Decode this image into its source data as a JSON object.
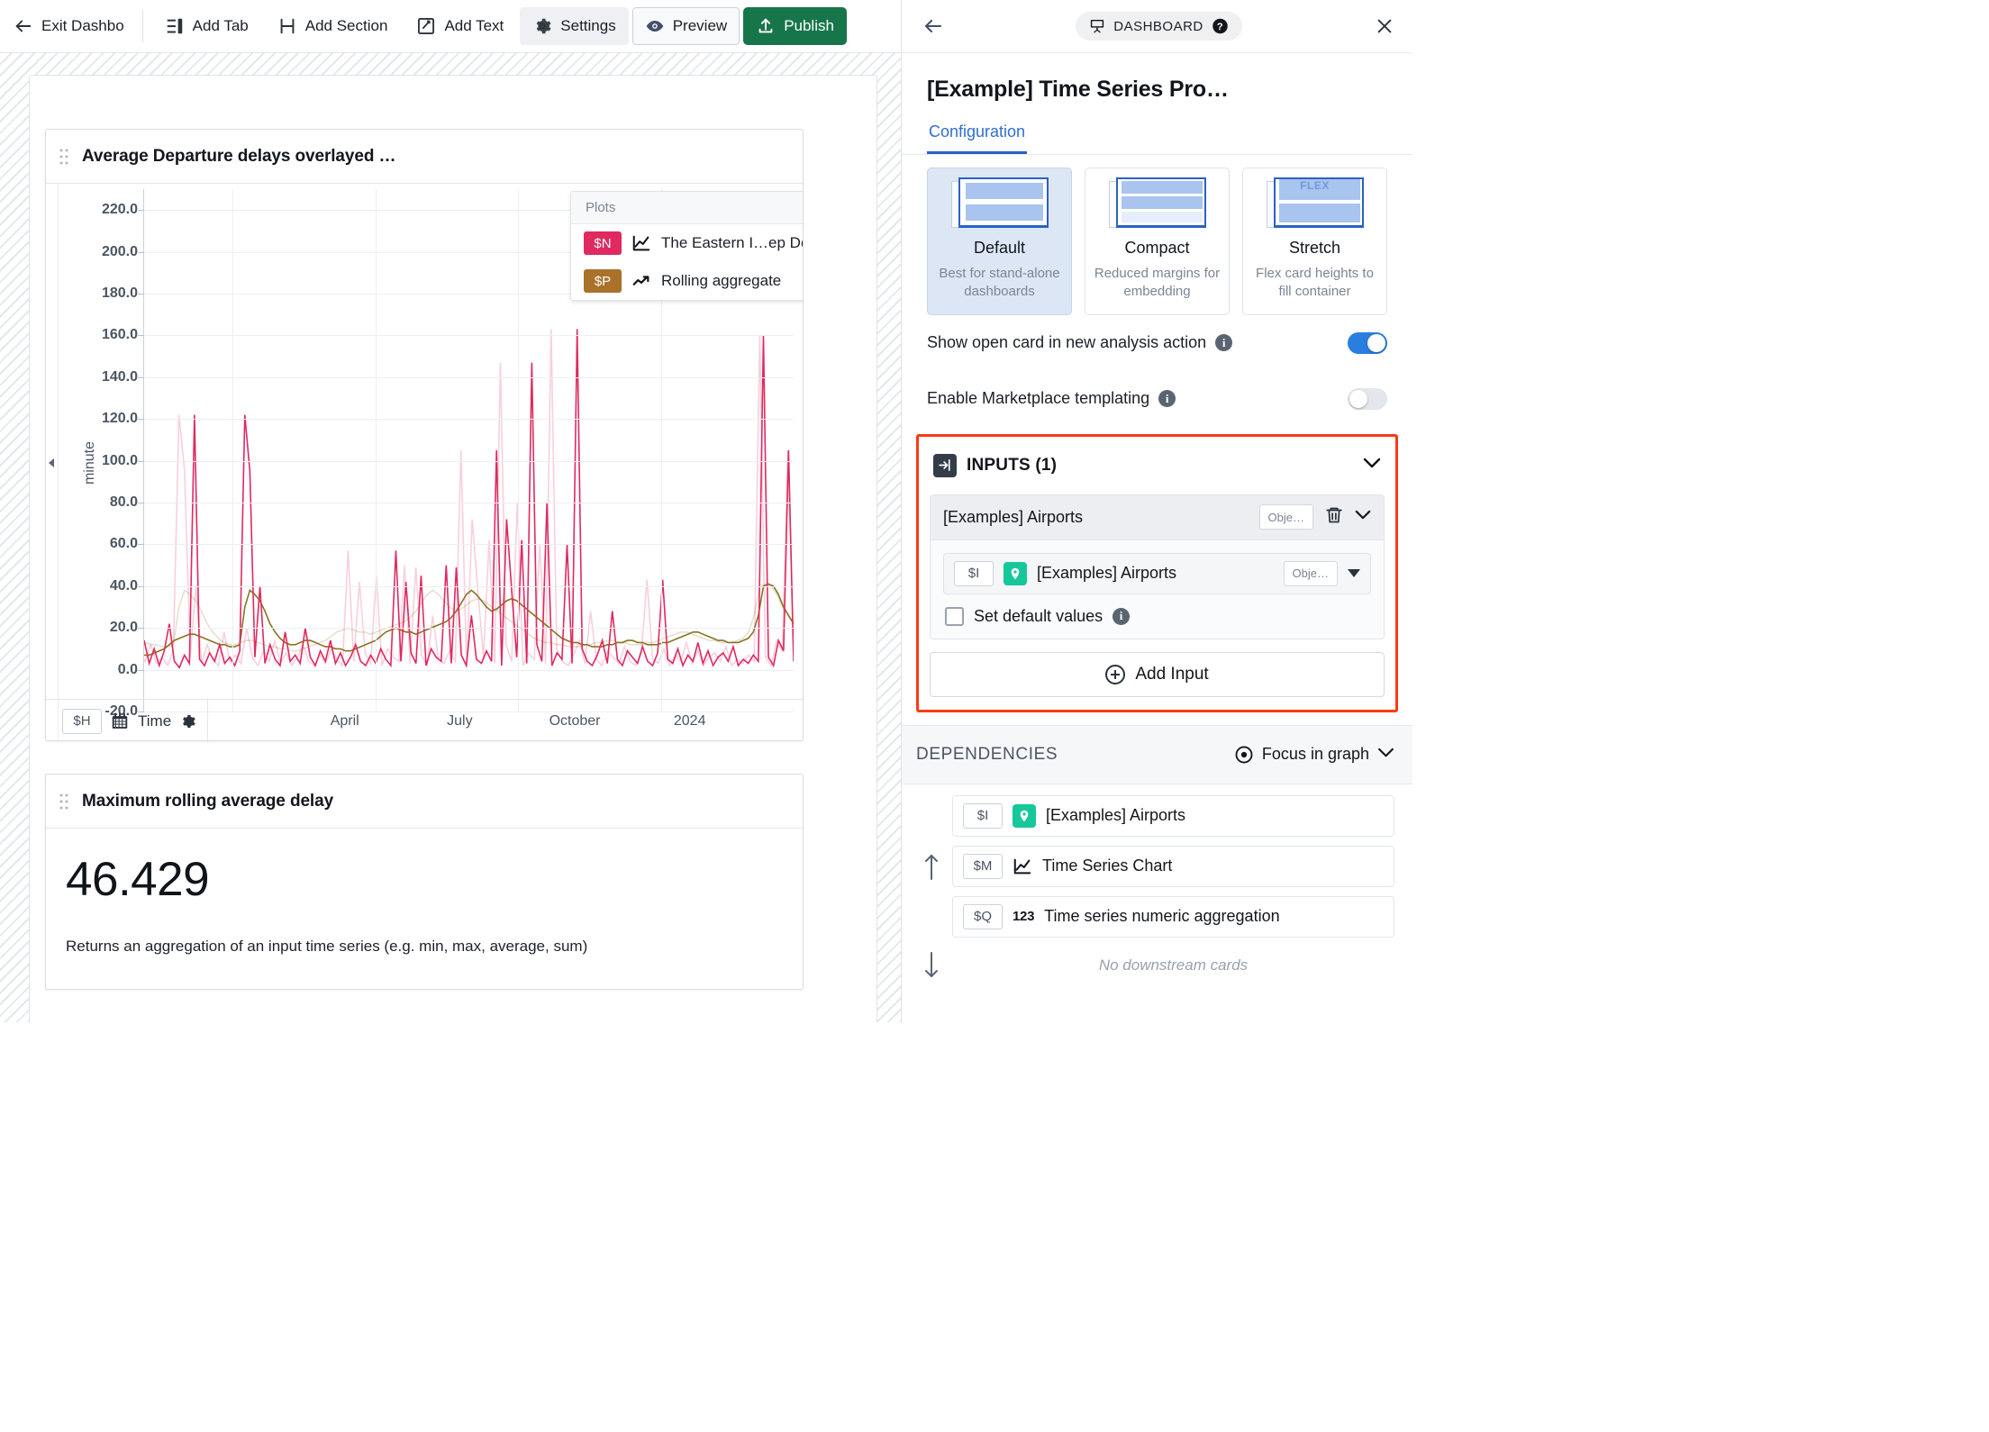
{
  "toolbar": {
    "exit_label": "Exit Dashbo",
    "add_tab_label": "Add Tab",
    "add_section_label": "Add Section",
    "add_text_label": "Add Text",
    "settings_label": "Settings",
    "preview_label": "Preview",
    "publish_label": "Publish",
    "publish_color": "#17754a"
  },
  "chart_card": {
    "title": "Average Departure delays overlayed …",
    "plots_tooltip": {
      "header": "Plots",
      "rows": [
        {
          "tag": "$N",
          "tag_color": "#e0295f",
          "icon": "line-chart-icon",
          "label": "The Eastern I…ep Delay"
        },
        {
          "tag": "$P",
          "tag_color": "#a9712a",
          "icon": "trend-up-icon",
          "label": "Rolling aggregate"
        }
      ]
    },
    "footer": {
      "variable_tag": "$H",
      "time_label": "Time",
      "gear_icon": "gear-icon"
    }
  },
  "chart_data": {
    "type": "line",
    "title": "Average Departure delays overlayed …",
    "xlabel": "",
    "ylabel": "minute",
    "ylim": [
      -20,
      230
    ],
    "yticks": [
      220.0,
      200.0,
      180.0,
      160.0,
      140.0,
      120.0,
      100.0,
      80.0,
      60.0,
      40.0,
      20.0,
      0.0,
      -20.0
    ],
    "ytick_labels": [
      "220.0",
      "200.0",
      "180.0",
      "160.0",
      "140.0",
      "120.0",
      "100.0",
      "80.0",
      "60.0",
      "40.0",
      "20.0",
      "0.0",
      "-20.0"
    ],
    "xticks": [
      "April",
      "July",
      "October",
      "2024"
    ],
    "grid": true,
    "legend_position": "floating-top-right",
    "series": [
      {
        "name": "The Eastern I…ep Delay",
        "tag": "$N",
        "color": "#e0295f",
        "values": [
          14,
          3,
          10,
          2,
          9,
          22,
          4,
          1,
          7,
          3,
          122,
          5,
          2,
          8,
          4,
          12,
          3,
          6,
          2,
          9,
          122,
          95,
          6,
          40,
          3,
          12,
          5,
          2,
          18,
          4,
          7,
          3,
          20,
          6,
          2,
          9,
          4,
          14,
          3,
          8,
          2,
          6,
          12,
          4,
          2,
          7,
          3,
          10,
          5,
          2,
          57,
          4,
          42,
          8,
          3,
          45,
          2,
          10,
          6,
          4,
          50,
          3,
          49,
          7,
          2,
          26,
          5,
          3,
          9,
          4,
          105,
          2,
          72,
          38,
          6,
          62,
          3,
          147,
          12,
          4,
          80,
          2,
          8,
          5,
          60,
          3,
          163,
          10,
          4,
          2,
          7,
          14,
          3,
          28,
          5,
          2,
          9,
          6,
          3,
          11,
          4,
          2,
          8,
          43,
          5,
          3,
          10,
          2,
          7,
          4,
          13,
          3,
          9,
          2,
          6,
          8,
          4,
          11,
          2,
          5,
          3,
          7,
          4,
          160,
          6,
          2,
          14,
          9,
          105,
          4
        ]
      },
      {
        "name": "Rolling aggregate",
        "tag": "$P",
        "color": "#8a7323",
        "values": [
          7,
          7,
          8,
          9,
          10,
          12,
          14,
          15,
          16,
          17,
          17,
          16,
          15,
          14,
          13,
          12,
          12,
          11,
          11,
          12,
          30,
          38,
          36,
          33,
          28,
          22,
          18,
          15,
          13,
          12,
          12,
          13,
          14,
          14,
          13,
          12,
          11,
          11,
          10,
          10,
          9,
          9,
          10,
          11,
          12,
          13,
          14,
          16,
          18,
          19,
          20,
          19,
          18,
          18,
          17,
          18,
          19,
          20,
          21,
          22,
          23,
          25,
          28,
          32,
          36,
          38,
          36,
          33,
          30,
          28,
          29,
          31,
          33,
          34,
          33,
          31,
          29,
          27,
          25,
          23,
          21,
          19,
          17,
          15,
          14,
          13,
          13,
          12,
          12,
          11,
          11,
          11,
          12,
          12,
          13,
          13,
          14,
          14,
          13,
          13,
          12,
          12,
          12,
          13,
          13,
          14,
          15,
          16,
          17,
          18,
          18,
          17,
          16,
          15,
          14,
          14,
          13,
          13,
          13,
          14,
          15,
          18,
          26,
          40,
          41,
          40,
          36,
          30,
          26,
          22
        ]
      }
    ]
  },
  "metric_card": {
    "title": "Maximum rolling average delay",
    "value": "46.429",
    "description": "Returns an aggregation of an input time series (e.g. min, max, average, sum)"
  },
  "right_panel": {
    "badge_label": "DASHBOARD",
    "title": "[Example] Time Series Pro…",
    "tab_label": "Configuration",
    "layouts": [
      {
        "name": "Default",
        "desc": "Best for stand-alone dashboards",
        "selected": true
      },
      {
        "name": "Compact",
        "desc": "Reduced margins for embedding",
        "selected": false
      },
      {
        "name": "Stretch",
        "desc": "Flex card heights to fill container",
        "selected": false,
        "thumb_word": "FLEX"
      }
    ],
    "toggles": [
      {
        "label": "Show open card in new analysis action",
        "state": "on"
      },
      {
        "label": "Enable Marketplace templating",
        "state": "off"
      }
    ],
    "inputs_section": {
      "title": "INPUTS (1)",
      "highlight_color": "#f93b16",
      "block": {
        "name": "[Examples] Airports",
        "type_pill": "Obje…",
        "field": {
          "variable_tag": "$I",
          "icon": "location-pin-icon",
          "label": "[Examples] Airports",
          "type_pill": "Obje…"
        },
        "checkbox_label": "Set default values",
        "checkbox_checked": false
      },
      "add_button_label": "Add Input"
    },
    "dependencies": {
      "title": "DEPENDENCIES",
      "focus_label": "Focus in graph",
      "items": [
        {
          "tag": "$I",
          "icon": "location-pin-icon",
          "label": "[Examples] Airports"
        },
        {
          "tag": "$M",
          "icon": "line-chart-icon",
          "label": "Time Series Chart"
        },
        {
          "tag": "$Q",
          "icon": "123-icon",
          "label": "Time series numeric aggregation"
        }
      ],
      "empty_downstream": "No downstream cards"
    }
  }
}
